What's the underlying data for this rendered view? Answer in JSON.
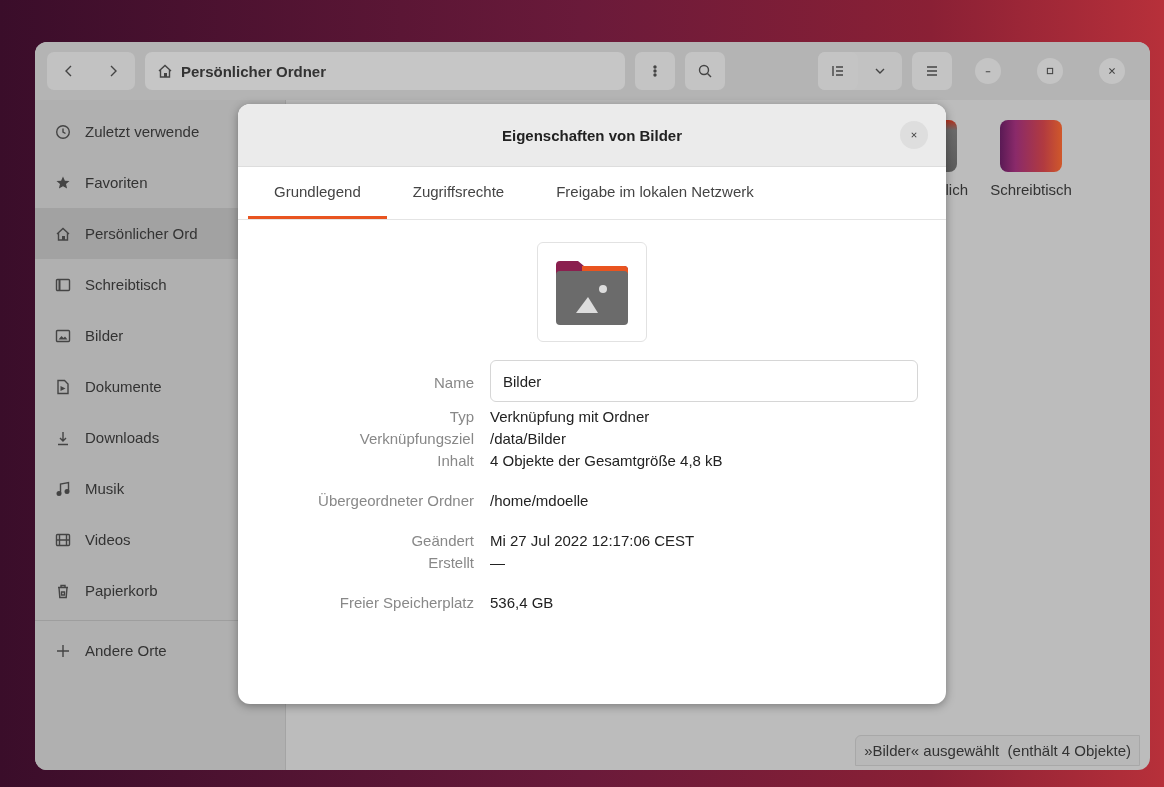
{
  "window": {
    "path": "Persönlicher Ordner"
  },
  "sidebar": {
    "items": [
      {
        "label": "Zuletzt verwende",
        "kind": "clock",
        "selected": false
      },
      {
        "label": "Favoriten",
        "kind": "star",
        "selected": false
      },
      {
        "label": "Persönlicher Ord",
        "kind": "home",
        "selected": true
      },
      {
        "label": "Schreibtisch",
        "kind": "desk",
        "selected": false
      },
      {
        "label": "Bilder",
        "kind": "image",
        "selected": false
      },
      {
        "label": "Dokumente",
        "kind": "doc",
        "selected": false
      },
      {
        "label": "Downloads",
        "kind": "download",
        "selected": false
      },
      {
        "label": "Musik",
        "kind": "music",
        "selected": false
      },
      {
        "label": "Videos",
        "kind": "video",
        "selected": false
      },
      {
        "label": "Papierkorb",
        "kind": "trash",
        "selected": false
      }
    ],
    "other": {
      "label": "Andere Orte"
    }
  },
  "files": [
    {
      "label": "lich",
      "kind": "dark"
    },
    {
      "label": "Schreibtisch",
      "kind": "desk"
    }
  ],
  "dialog": {
    "title": "Eigenschaften von Bilder",
    "tabs": [
      {
        "label": "Grundlegend",
        "selected": true
      },
      {
        "label": "Zugriffsrechte",
        "selected": false
      },
      {
        "label": "Freigabe im lokalen Netzwerk",
        "selected": false
      }
    ],
    "sections": [
      [
        {
          "label": "Name",
          "value": "Bilder",
          "kind": "field"
        },
        {
          "label": "Typ",
          "value": "Verknüpfung mit Ordner",
          "kind": "text"
        },
        {
          "label": "Verknüpfungsziel",
          "value": "/data/Bilder",
          "kind": "text"
        },
        {
          "label": "Inhalt",
          "value": "4 Objekte der Gesamtgröße 4,8 kB",
          "kind": "text"
        }
      ],
      [
        {
          "label": "Übergeordneter Ordner",
          "value": "/home/mdoelle",
          "kind": "text"
        }
      ],
      [
        {
          "label": "Geändert",
          "value": "Mi 27 Jul 2022 12:17:06 CEST",
          "kind": "text"
        },
        {
          "label": "Erstellt",
          "value": "—",
          "kind": "text"
        }
      ],
      [
        {
          "label": "Freier Speicherplatz",
          "value": "536,4 GB",
          "kind": "text"
        }
      ]
    ]
  },
  "status_bar": "»Bilder« ausgewählt  (enthält 4 Objekte)"
}
